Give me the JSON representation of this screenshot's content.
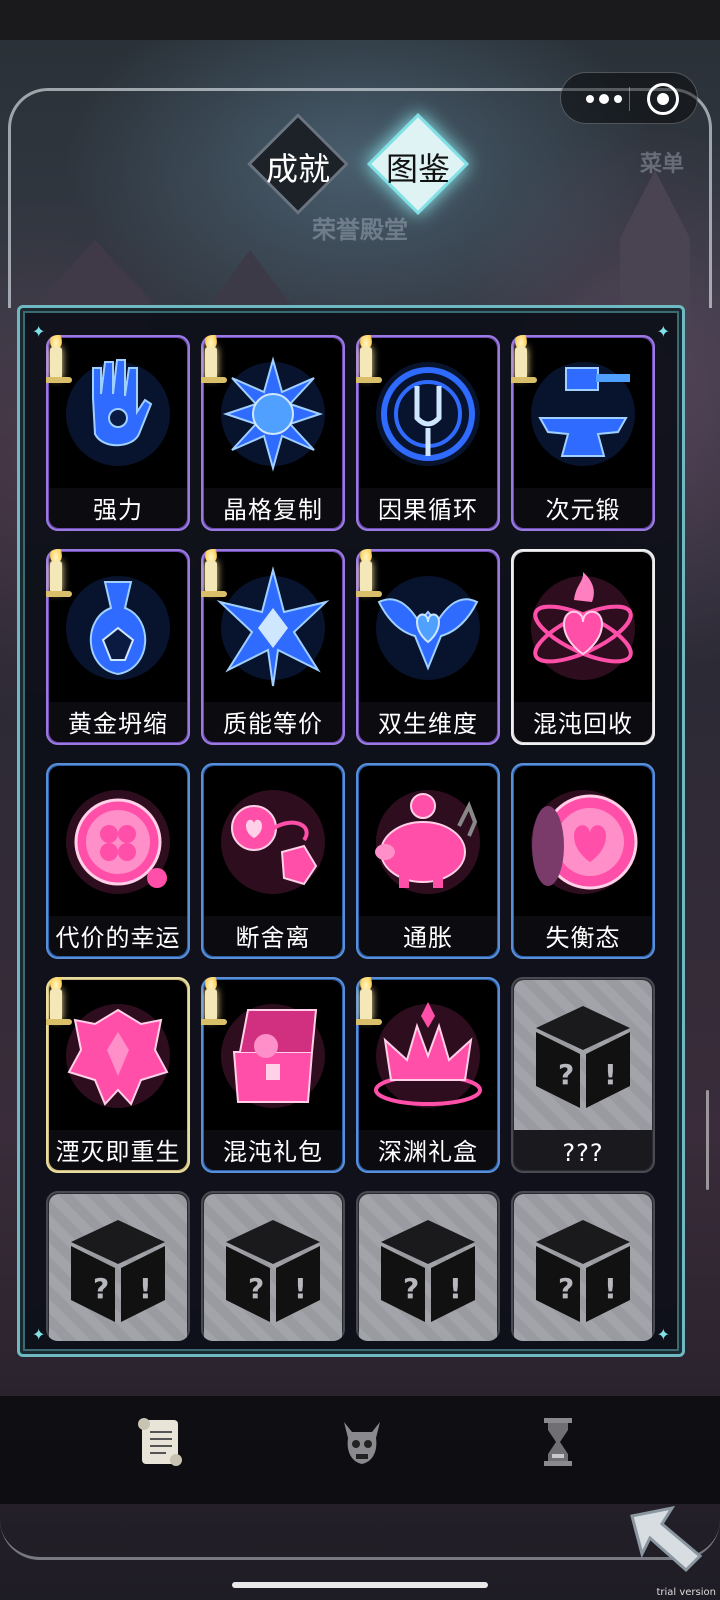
{
  "capsule": {
    "more_icon": "more-dots-icon",
    "close_icon": "target-icon"
  },
  "tabs": {
    "achievements": "成就",
    "atlas": "图鉴"
  },
  "background_text": {
    "menu": "菜单",
    "hall": "荣誉殿堂"
  },
  "cards": [
    {
      "label": "强力",
      "frame": "purple",
      "candle": true,
      "icon": "crystal-hand-icon",
      "color": "#2f6bff"
    },
    {
      "label": "晶格复制",
      "frame": "purple",
      "candle": true,
      "icon": "star-orb-icon",
      "color": "#2f6bff"
    },
    {
      "label": "因果循环",
      "frame": "purple",
      "candle": true,
      "icon": "tuning-fork-icon",
      "color": "#2f6bff"
    },
    {
      "label": "次元锻",
      "frame": "purple",
      "candle": true,
      "icon": "anvil-hammer-icon",
      "color": "#2f6bff"
    },
    {
      "label": "黄金坍缩",
      "frame": "purple",
      "candle": true,
      "icon": "gem-flask-icon",
      "color": "#2f6bff"
    },
    {
      "label": "质能等价",
      "frame": "purple",
      "candle": true,
      "icon": "crystal-star-icon",
      "color": "#2f6bff"
    },
    {
      "label": "双生维度",
      "frame": "purple",
      "candle": true,
      "icon": "crystal-heart-wings-icon",
      "color": "#2f6bff"
    },
    {
      "label": "混沌回收",
      "frame": "white",
      "candle": false,
      "icon": "atom-heart-icon",
      "color": "#ff4fa8"
    },
    {
      "label": "代价的幸运",
      "frame": "blue",
      "candle": false,
      "icon": "clover-coin-icon",
      "color": "#ff4fa8"
    },
    {
      "label": "断舍离",
      "frame": "blue",
      "candle": false,
      "icon": "broken-heart-icon",
      "color": "#ff4fa8"
    },
    {
      "label": "通胀",
      "frame": "blue",
      "candle": false,
      "icon": "piggy-bank-icon",
      "color": "#ff4fa8"
    },
    {
      "label": "失衡态",
      "frame": "blue",
      "candle": false,
      "icon": "heart-coin-icon",
      "color": "#ff4fa8"
    },
    {
      "label": "湮灭即重生",
      "frame": "gold",
      "candle": true,
      "icon": "crystal-phoenix-icon",
      "color": "#ff4fa8"
    },
    {
      "label": "混沌礼包",
      "frame": "blue",
      "candle": true,
      "icon": "treasure-chest-icon",
      "color": "#ff4fa8"
    },
    {
      "label": "深渊礼盒",
      "frame": "blue",
      "candle": true,
      "icon": "crown-icon",
      "color": "#ff4fa8"
    },
    {
      "label": "???",
      "frame": "locked",
      "candle": false,
      "icon": "mystery-box-icon",
      "color": "#111111"
    },
    {
      "label": "",
      "frame": "locked",
      "candle": false,
      "icon": "mystery-box-icon",
      "color": "#111111"
    },
    {
      "label": "",
      "frame": "locked",
      "candle": false,
      "icon": "mystery-box-icon",
      "color": "#111111"
    },
    {
      "label": "",
      "frame": "locked",
      "candle": false,
      "icon": "mystery-box-icon",
      "color": "#111111"
    },
    {
      "label": "",
      "frame": "locked",
      "candle": false,
      "icon": "mystery-box-icon",
      "color": "#111111"
    }
  ],
  "bottom_nav": [
    {
      "icon": "scroll-icon"
    },
    {
      "icon": "demon-skull-icon"
    },
    {
      "icon": "hourglass-icon"
    }
  ],
  "back_icon": "back-arrow-icon",
  "watermark": "trial version"
}
